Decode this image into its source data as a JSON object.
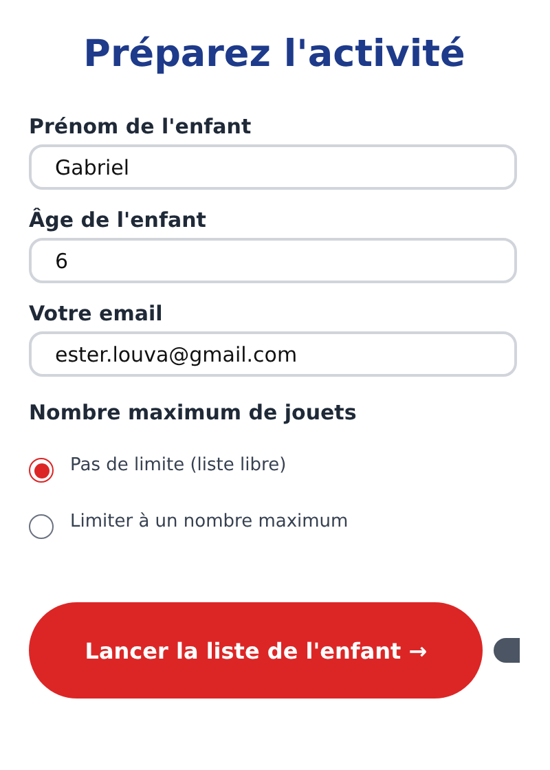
{
  "title": "Préparez l'activité",
  "fields": [
    {
      "label": "Prénom de l'enfant",
      "value": "Gabriel"
    },
    {
      "label": "Âge de l'enfant",
      "value": "6"
    },
    {
      "label": "Votre email",
      "value": "ester.louva@gmail.com"
    }
  ],
  "limit": {
    "label": "Nombre maximum de jouets",
    "options": [
      {
        "label": "Pas de limite (liste libre)",
        "selected": true
      },
      {
        "label": "Limiter à un nombre maximum",
        "selected": false
      }
    ]
  },
  "submit": {
    "label": "Lancer la liste de l'enfant →"
  }
}
